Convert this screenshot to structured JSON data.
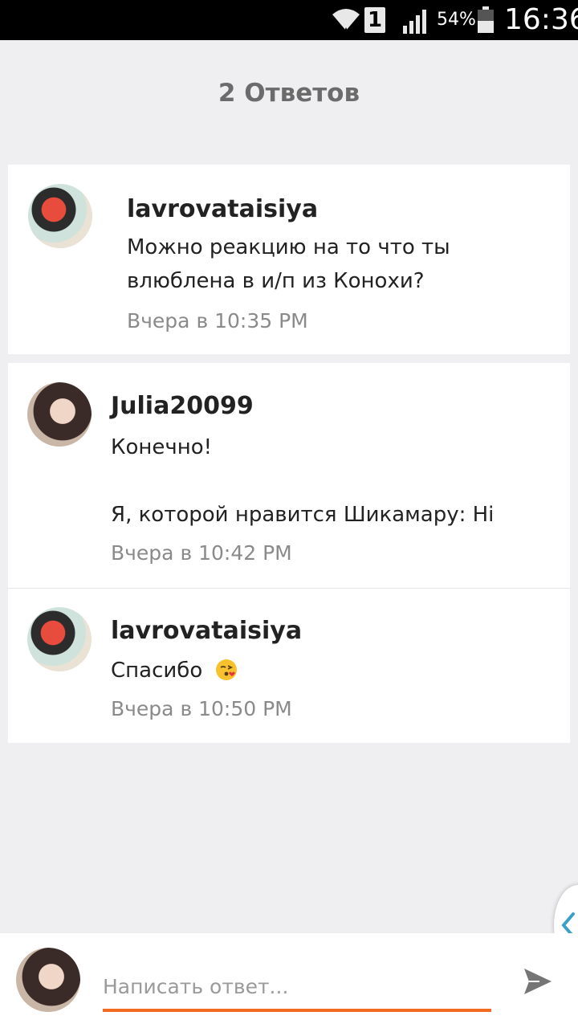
{
  "statusbar": {
    "sim_label": "1",
    "battery_pct": "54%",
    "time": "16:36"
  },
  "header": {
    "title": "2 Ответов"
  },
  "comments": [
    {
      "username": "lavrovataisiya",
      "message": "Можно реакцию на то что ты влюблена в и/п из Конохи?",
      "timestamp": "Вчера в 10:35 PM",
      "avatar": "avatar-lavrovataisiya"
    },
    {
      "username": "Julia20099",
      "message": "Конечно!\n\nЯ, которой нравится Шикамару: Hi",
      "timestamp": "Вчера в 10:42 PM",
      "avatar": "avatar-julia20099"
    },
    {
      "username": "lavrovataisiya",
      "message": "Спасибо",
      "emoji": "kissing-face-emoji",
      "timestamp": "Вчера в 10:50 PM",
      "avatar": "avatar-lavrovataisiya"
    }
  ],
  "composer": {
    "placeholder": "Написать ответ...",
    "accent_color": "#f26b21"
  },
  "icons": {
    "send": "send-icon",
    "side_tab": "chevron-left-icon"
  }
}
